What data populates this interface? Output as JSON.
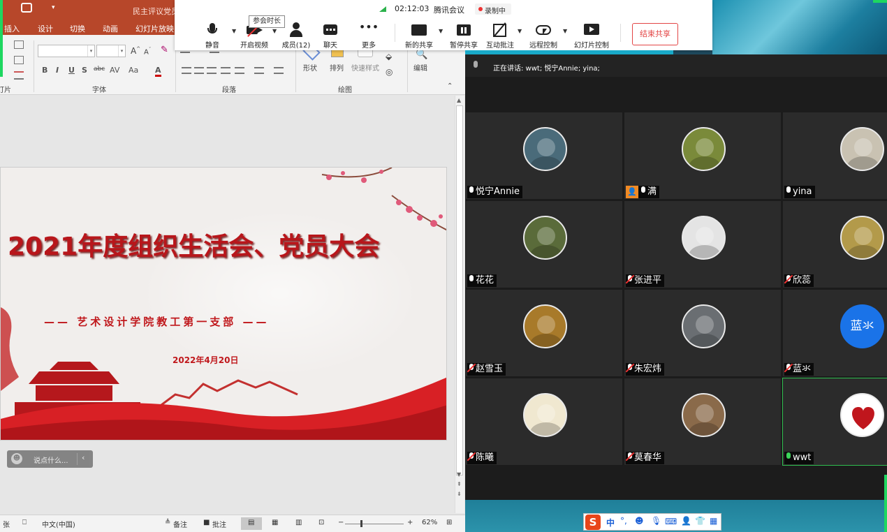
{
  "ppt": {
    "title_fragment": "民主评议党员",
    "tabs": [
      "插入",
      "设计",
      "切换",
      "动画",
      "幻灯片放映"
    ],
    "group_labels": {
      "slides": "幻灯片",
      "font": "字体",
      "paragraph": "段落",
      "drawing": "绘图"
    },
    "drawing_buttons": {
      "shape": "形状",
      "arrange": "排列",
      "quick_style": "快速样式",
      "edit": "编辑"
    },
    "format_buttons": [
      "B",
      "I",
      "U",
      "S",
      "abc",
      "AV",
      "Aa",
      "A"
    ],
    "status": {
      "slide_fragment": "张",
      "language": "中文(中国)",
      "notes": "备注",
      "comments": "批注",
      "zoom": "62%"
    },
    "say_something": "说点什么..."
  },
  "slide": {
    "title": "2021年度组织生活会、党员大会",
    "subtitle": "——  艺术设计学院教工第一支部  ——",
    "date": "2022年4月20日"
  },
  "meeting": {
    "signal": "02:12:03",
    "app_name": "腾讯会议",
    "recording": "录制中",
    "tooltip": "参会时长",
    "buttons": {
      "mute": "静音",
      "video": "开启视频",
      "members": "成员(12)",
      "chat": "聊天",
      "more": "更多",
      "new_share": "新的共享",
      "pause_share": "暂停共享",
      "annotate": "互动批注",
      "remote": "远程控制",
      "slides": "幻灯片控制"
    },
    "end_share": "结束共享",
    "speaking": "正在讲话: wwt; 悦宁Annie; yina;"
  },
  "participants": [
    {
      "name": "悦宁Annie",
      "mic": "on",
      "bg": "#4a6b7a"
    },
    {
      "name": "满",
      "mic": "on",
      "host": true,
      "bg": "#7a8a3a"
    },
    {
      "name": "yina",
      "mic": "on",
      "bg": "#c9c2b2"
    },
    {
      "name": "花花",
      "mic": "on",
      "bg": "#5a6b3a"
    },
    {
      "name": "张进平",
      "mic": "muted",
      "bg": "#e4e4e4"
    },
    {
      "name": "欣蕊",
      "mic": "muted",
      "bg": "#b39a4a"
    },
    {
      "name": "赵雪玉",
      "mic": "muted",
      "bg": "#a87a2a"
    },
    {
      "name": "朱宏炜",
      "mic": "muted",
      "bg": "#6a6e72"
    },
    {
      "name": "蓝氺",
      "mic": "muted",
      "initial": "蓝氺",
      "bg": "#1a73e8"
    },
    {
      "name": "陈曦",
      "mic": "muted",
      "bg": "#f0e8d0"
    },
    {
      "name": "莫春华",
      "mic": "muted",
      "bg": "#8a6a4a"
    },
    {
      "name": "wwt",
      "mic": "active",
      "bg": "#ffffff",
      "speaking": true
    }
  ],
  "ime": {
    "lang": "中"
  }
}
